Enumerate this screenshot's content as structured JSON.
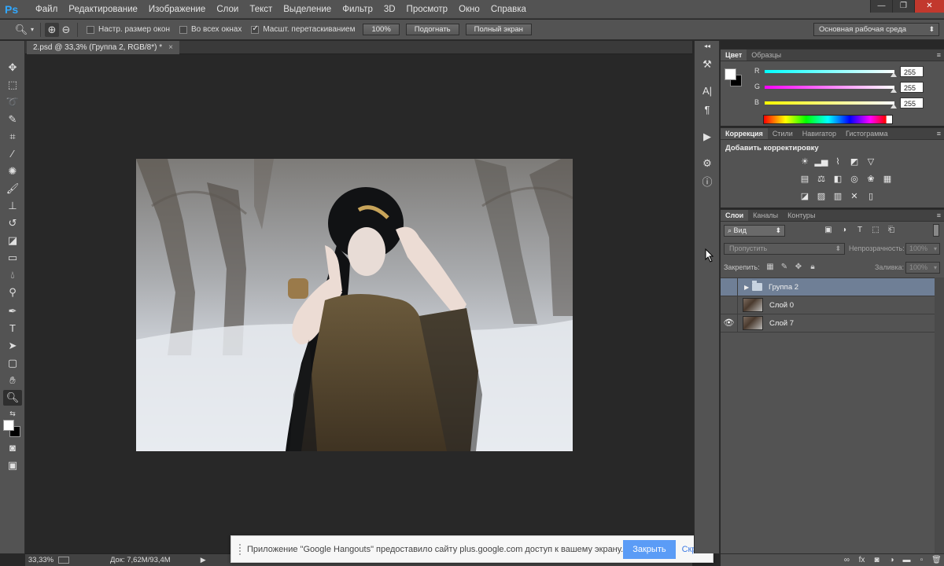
{
  "app": {
    "logo": "Ps"
  },
  "menu": [
    "Файл",
    "Редактирование",
    "Изображение",
    "Слои",
    "Текст",
    "Выделение",
    "Фильтр",
    "3D",
    "Просмотр",
    "Окно",
    "Справка"
  ],
  "window_controls": {
    "minimize": "—",
    "maximize": "❐",
    "close": "✕"
  },
  "options_bar": {
    "resize_windows": {
      "label": "Настр. размер окон",
      "checked": false
    },
    "all_windows": {
      "label": "Во всех окнах",
      "checked": false
    },
    "scrubby_zoom": {
      "label": "Масшт. перетаскиванием",
      "checked": true
    },
    "buttons": [
      "100%",
      "Подогнать",
      "Полный экран"
    ],
    "workspace": "Основная рабочая среда"
  },
  "document": {
    "tab_title": "2.psd @ 33,3% (Группа 2, RGB/8*) *",
    "zoom": "33,33%",
    "doc_size": "Док: 7,62M/93,4M"
  },
  "color_panel": {
    "tabs": [
      "Цвет",
      "Образцы"
    ],
    "sliders": [
      {
        "label": "R",
        "value": "255",
        "gradient": "linear-gradient(90deg,#00ffff,#ffffff)"
      },
      {
        "label": "G",
        "value": "255",
        "gradient": "linear-gradient(90deg,#ff00ff,#ffffff)"
      },
      {
        "label": "B",
        "value": "255",
        "gradient": "linear-gradient(90deg,#ffff00,#ffffff)"
      }
    ]
  },
  "adjustments_panel": {
    "tabs": [
      "Коррекция",
      "Стили",
      "Навигатор",
      "Гистограмма"
    ],
    "title": "Добавить корректировку"
  },
  "layers_panel": {
    "tabs": [
      "Слои",
      "Каналы",
      "Контуры"
    ],
    "filter": "Вид",
    "blend_mode": "Пропустить",
    "opacity_label": "Непрозрачность:",
    "opacity_value": "100%",
    "lock_label": "Закрепить:",
    "fill_label": "Заливка:",
    "fill_value": "100%",
    "layers": [
      {
        "name": "Группа 2",
        "type": "group",
        "visible": false,
        "selected": true
      },
      {
        "name": "Слой 0",
        "type": "layer",
        "visible": false,
        "selected": false
      },
      {
        "name": "Слой 7",
        "type": "layer",
        "visible": true,
        "selected": false
      }
    ]
  },
  "notification": {
    "text": "Приложение \"Google Hangouts\" предоставило сайту plus.google.com доступ к вашему экрану.",
    "primary_button": "Закрыть доступ",
    "secondary_button": "Скрыть"
  }
}
